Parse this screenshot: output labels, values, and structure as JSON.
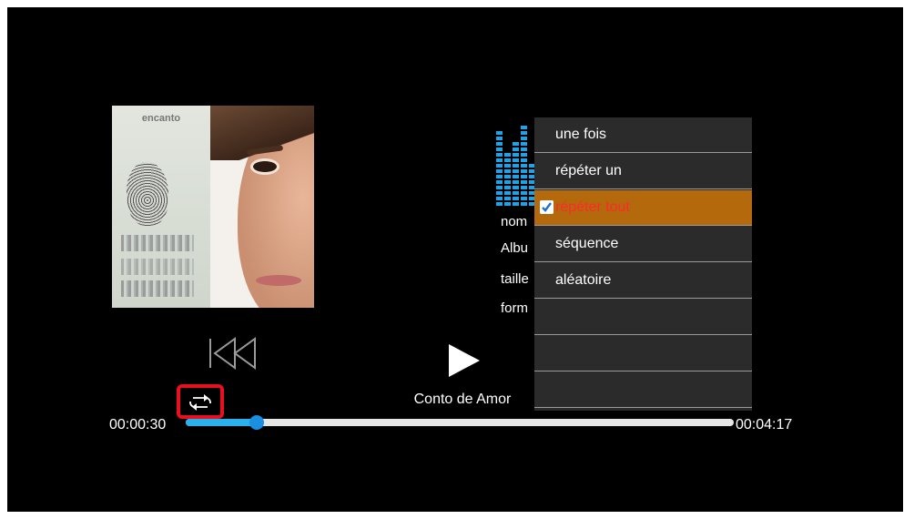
{
  "player": {
    "song_title": "Conto de Amor",
    "time_current": "00:00:30",
    "time_total": "00:04:17",
    "progress_fraction": 0.13
  },
  "info": {
    "name_label": "nom",
    "album_label": "Albu",
    "size_label": "taille",
    "format_label": "form"
  },
  "album_art": {
    "word": "encanto"
  },
  "repeat_menu": {
    "items": [
      {
        "label": "une fois",
        "selected": false
      },
      {
        "label": "répéter un",
        "selected": false
      },
      {
        "label": "répéter tout",
        "selected": true
      },
      {
        "label": "séquence",
        "selected": false
      },
      {
        "label": "aléatoire",
        "selected": false
      },
      {
        "label": "",
        "selected": false
      },
      {
        "label": "",
        "selected": false
      },
      {
        "label": "",
        "selected": false
      }
    ]
  },
  "colors": {
    "selected_bg": "#b3690c",
    "selected_text": "#ff2a2a",
    "progress_fill": "#2ab0ea",
    "highlight_border": "#e8101e"
  }
}
